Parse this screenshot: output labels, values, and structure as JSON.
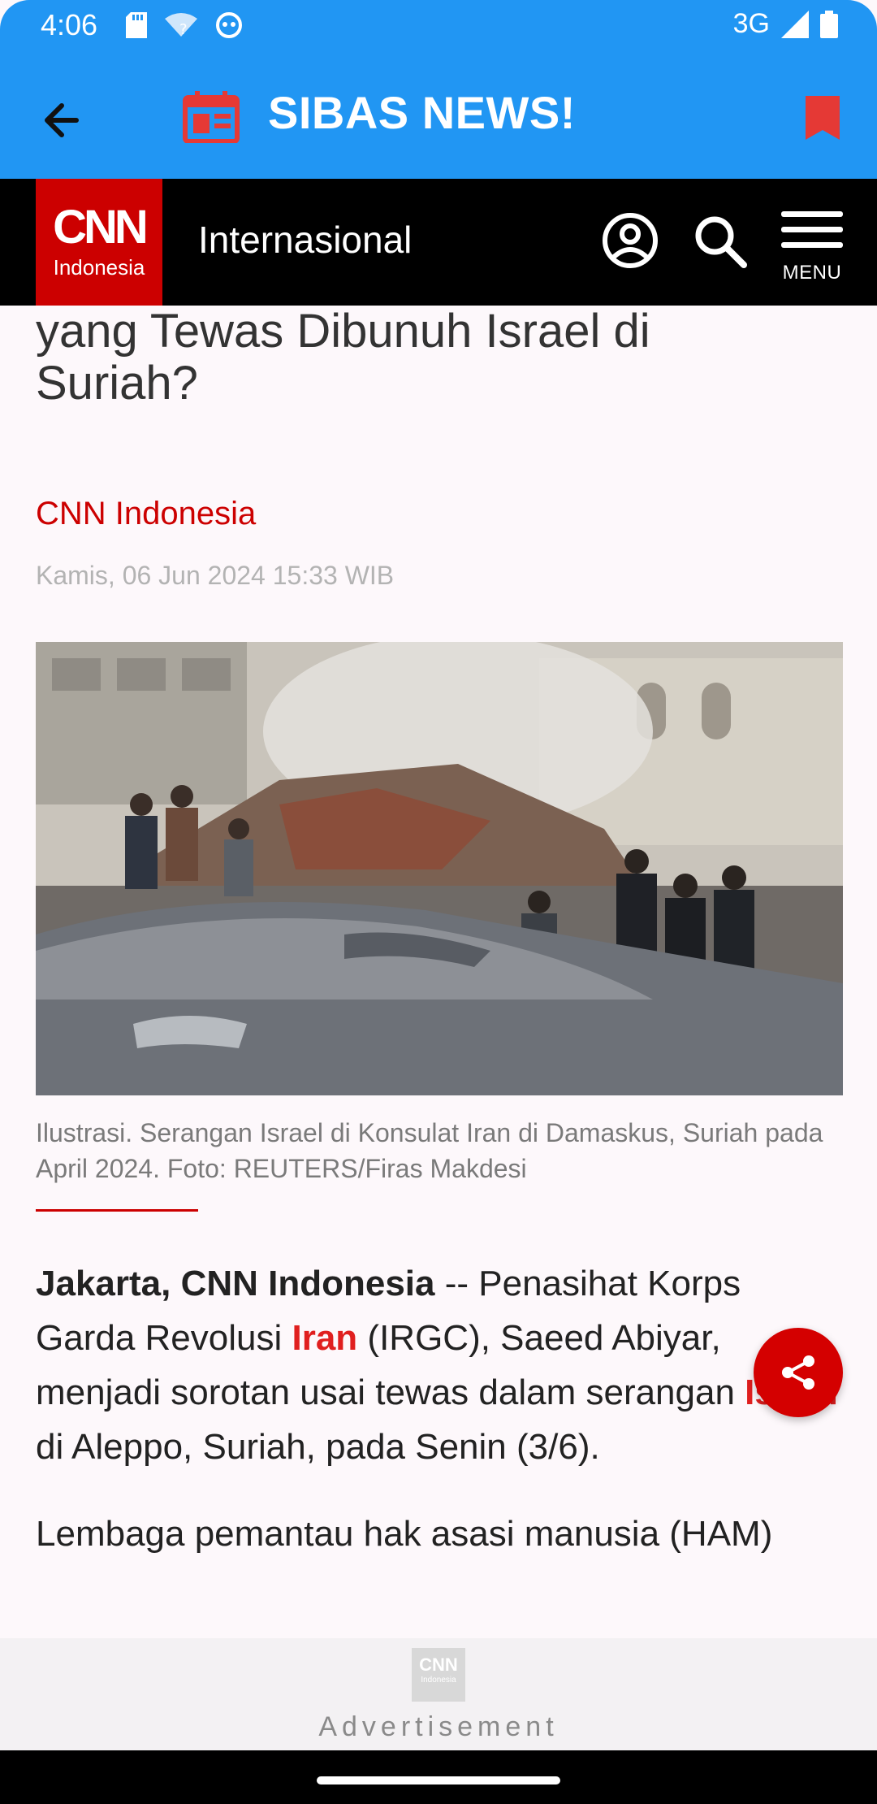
{
  "status": {
    "time": "4:06",
    "network": "3G"
  },
  "app_bar": {
    "title": "SIBAS NEWS!"
  },
  "site_header": {
    "logo_main": "CNN",
    "logo_sub": "Indonesia",
    "section": "Internasional",
    "menu_label": "MENU"
  },
  "article": {
    "title_line1": "yang Tewas Dibunuh Israel di",
    "title_line2": "Suriah?",
    "source": "CNN Indonesia",
    "date": "Kamis, 06 Jun 2024 15:33 WIB",
    "caption": "Ilustrasi. Serangan Israel di Konsulat Iran di Damaskus, Suriah pada April 2024. Foto: REUTERS/Firas Makdesi",
    "p1_lead": "Jakarta, CNN Indonesia",
    "p1_a": " -- Penasihat Korps Garda Revolusi ",
    "p1_link1": "Iran",
    "p1_b": " (IRGC), Saeed Abiyar, menjadi sorotan usai tewas dalam serangan ",
    "p1_link2": "Israel",
    "p1_c": " di Aleppo, Suriah, pada Senin (3/6).",
    "p2": "Lembaga pemantau hak asasi manusia (HAM)"
  },
  "ad": {
    "logo_main": "CNN",
    "logo_sub": "Indonesia",
    "label": "Advertisement"
  },
  "colors": {
    "app_bar": "#2196f3",
    "brand_red": "#cc0000",
    "link_red": "#e01f1f"
  }
}
